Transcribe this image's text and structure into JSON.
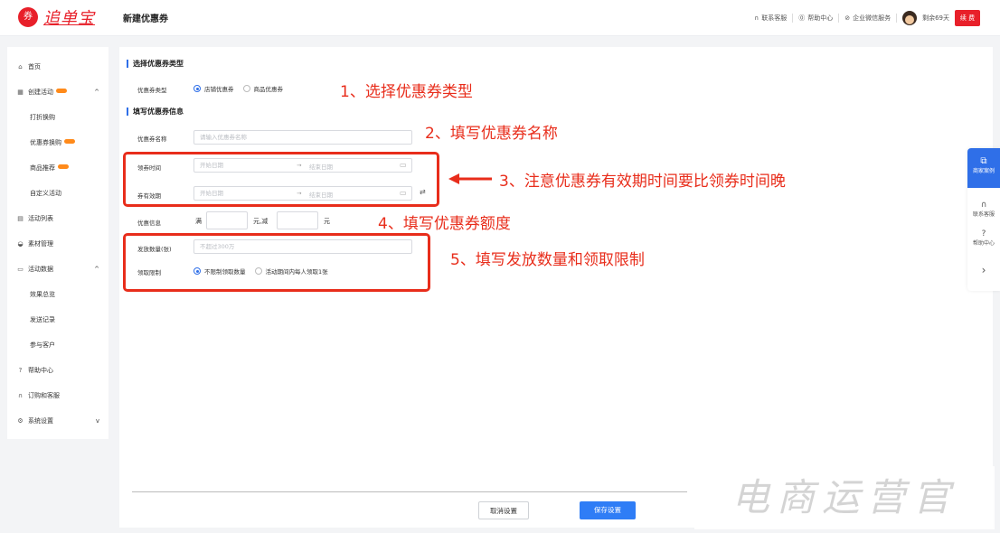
{
  "brand": {
    "logo_text": "追单宝",
    "accent": "#e8202a"
  },
  "header": {
    "title": "新建优惠券",
    "links": [
      "联系客服",
      "帮助中心",
      "企业微信服务"
    ],
    "remaining": "剩余69天",
    "renew_label": "续 费"
  },
  "sidebar": {
    "items": [
      {
        "label": "首页",
        "icon": "home-icon"
      },
      {
        "label": "创建活动",
        "icon": "calendar-icon",
        "badge": true,
        "caret": "^"
      },
      {
        "label": "打折换购"
      },
      {
        "label": "优惠券换购",
        "badge": true
      },
      {
        "label": "商品推荐",
        "badge": true
      },
      {
        "label": "自定义活动"
      },
      {
        "label": "活动列表",
        "icon": "list-icon"
      },
      {
        "label": "素材管理",
        "icon": "folder-icon"
      },
      {
        "label": "活动数据",
        "icon": "chart-icon",
        "caret": "^"
      },
      {
        "label": "效果总览"
      },
      {
        "label": "发送记录"
      },
      {
        "label": "参与客户"
      },
      {
        "label": "帮助中心",
        "icon": "help-icon"
      },
      {
        "label": "订购和客服",
        "icon": "headset-icon"
      },
      {
        "label": "系统设置",
        "icon": "gear-icon",
        "caret": "v"
      }
    ]
  },
  "form": {
    "section1": "选择优惠券类型",
    "coupon_type_label": "优惠券类型",
    "coupon_type_options": [
      "店铺优惠券",
      "商品优惠券"
    ],
    "section2": "填写优惠券信息",
    "name_label": "优惠券名称",
    "name_placeholder": "请输入优惠券名称",
    "claim_time_label": "领券时间",
    "valid_label": "券有效期",
    "start_placeholder": "开始日期",
    "end_placeholder": "结束日期",
    "range_sep": "→",
    "discount_label": "优惠信息",
    "discount_full": "满",
    "discount_mid": "元,减",
    "discount_unit": "元",
    "quantity_label": "发放数量(张)",
    "quantity_placeholder": "不超过300万",
    "limit_label": "领取限制",
    "limit_options": [
      "不限制领取数量",
      "活动期间内每人领取1张"
    ]
  },
  "annotations": {
    "a1": "1、选择优惠券类型",
    "a2": "2、填写优惠券名称",
    "a3": "3、注意优惠券有效期时间要比领券时间晚",
    "a4": "4、填写优惠券额度",
    "a5": "5、填写发放数量和领取限制"
  },
  "footer": {
    "cancel_label": "取消设置",
    "save_label": "保存设置"
  },
  "float_bar": {
    "case_label": "商家案例",
    "service_label": "联系客服",
    "help_label": "帮助中心"
  },
  "watermark": "电商运营官"
}
